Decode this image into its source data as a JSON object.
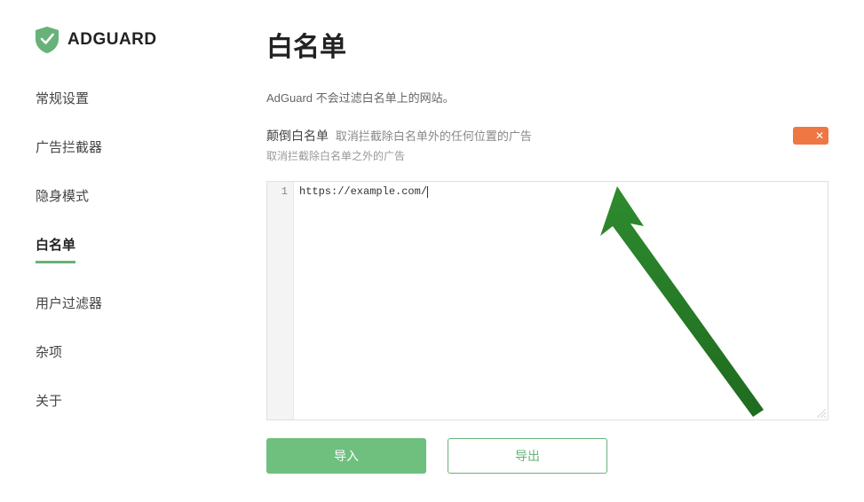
{
  "brand": {
    "name": "ADGUARD"
  },
  "nav": {
    "items": [
      {
        "label": "常规设置"
      },
      {
        "label": "广告拦截器"
      },
      {
        "label": "隐身模式"
      },
      {
        "label": "白名单"
      },
      {
        "label": "用户过滤器"
      },
      {
        "label": "杂项"
      },
      {
        "label": "关于"
      }
    ],
    "activeIndex": 3
  },
  "page": {
    "title": "白名单",
    "description": "AdGuard 不会过滤白名单上的网站。",
    "invert": {
      "label": "颠倒白名单",
      "sublabel": "取消拦截除白名单外的任何位置的广告",
      "hint": "取消拦截除白名单之外的广告",
      "enabled": false
    }
  },
  "editor": {
    "lines": [
      "https://example.com/"
    ],
    "lineNumbers": [
      "1"
    ]
  },
  "buttons": {
    "import": "导入",
    "export": "导出"
  },
  "colors": {
    "accent": "#67b279",
    "toggleOff": "#ee7744"
  }
}
